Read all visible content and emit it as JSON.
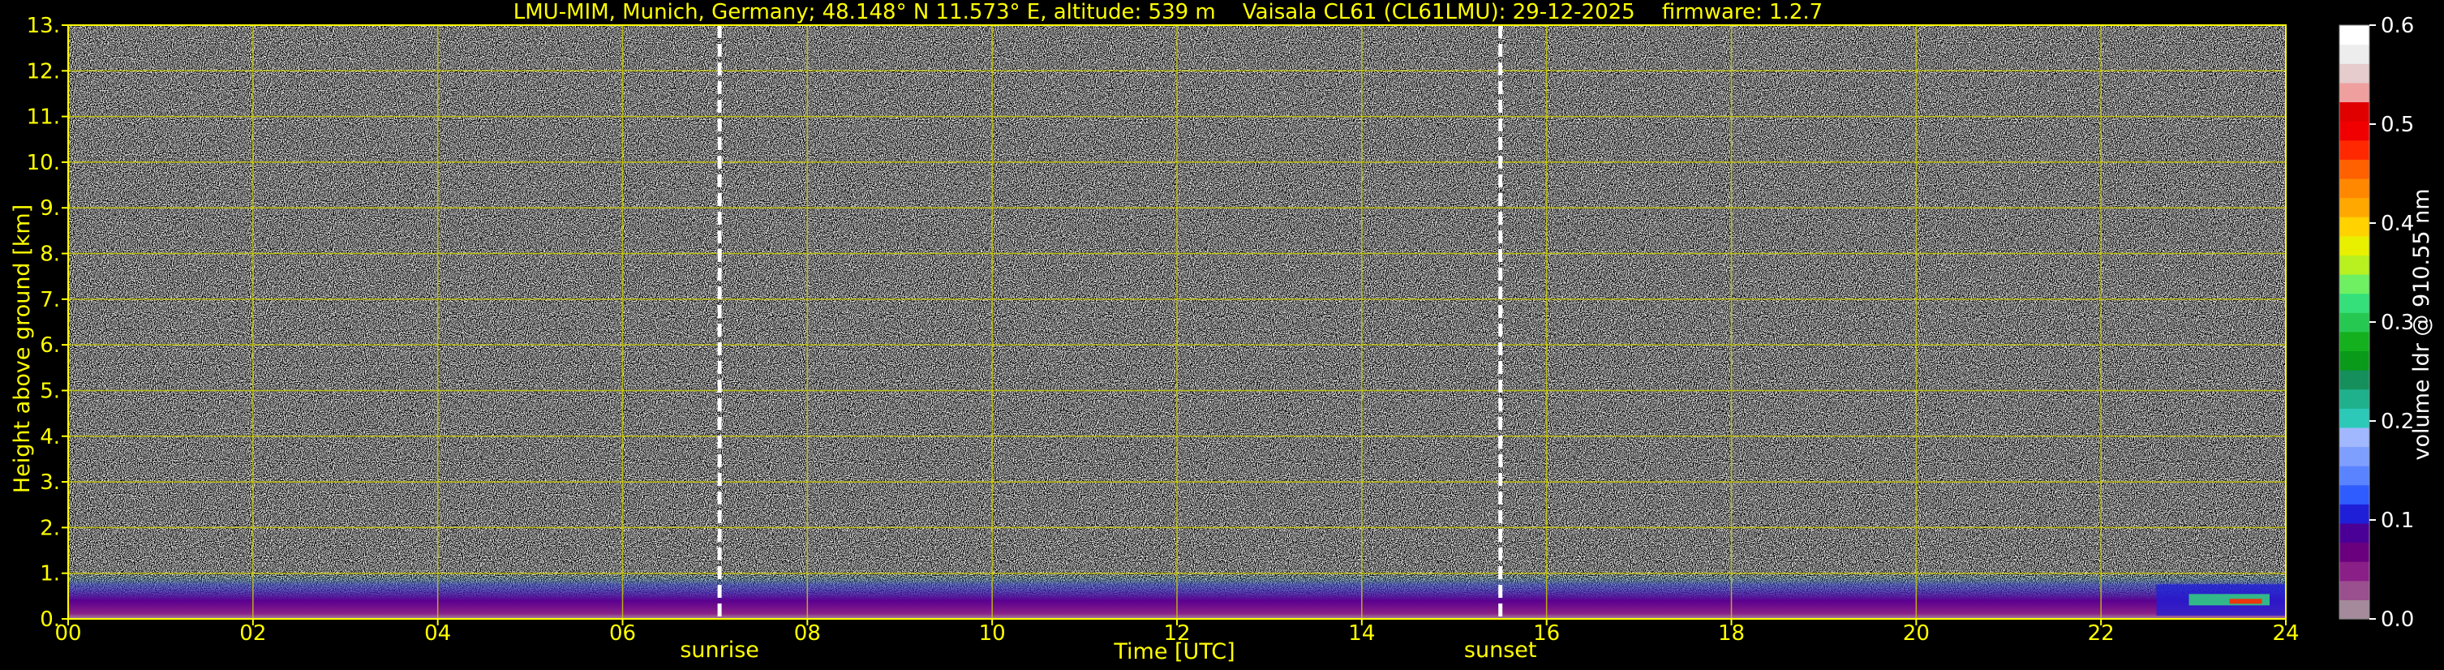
{
  "title": {
    "station": "LMU-MIM, Munich, Germany; 48.148° N 11.573° E, altitude: 539 m",
    "instrument": "Vaisala CL61 (CL61LMU): 29-12-2025",
    "firmware": "firmware: 1.2.7"
  },
  "chart_data": {
    "type": "heatmap",
    "title": "LMU-MIM, Munich, Germany; 48.148° N 11.573° E, altitude: 539 m    Vaisala CL61 (CL61LMU): 29-12-2025    firmware: 1.2.7",
    "xlabel": "Time [UTC]",
    "ylabel": "Height above ground [km]",
    "xlim": [
      0,
      24
    ],
    "ylim": [
      0,
      13
    ],
    "x_ticks": [
      "00",
      "02",
      "04",
      "06",
      "08",
      "10",
      "12",
      "14",
      "16",
      "18",
      "20",
      "22",
      "24"
    ],
    "y_ticks": [
      "0.",
      "1.",
      "2.",
      "3.",
      "4.",
      "5.",
      "6.",
      "7.",
      "8.",
      "9.",
      "10.",
      "11.",
      "12.",
      "13."
    ],
    "grid": true,
    "annotations": [
      {
        "label": "sunrise",
        "x": 7.05
      },
      {
        "label": "sunset",
        "x": 15.5
      }
    ],
    "colorbar": {
      "label": "volume ldr @ 910.55 nm",
      "range": [
        0.0,
        0.6
      ],
      "ticks": [
        "0.0",
        "0.1",
        "0.2",
        "0.3",
        "0.4",
        "0.5",
        "0.6"
      ],
      "colors": [
        "#a48a9a",
        "#9a4f8e",
        "#8a1f88",
        "#6a007e",
        "#4a0096",
        "#1f1fd8",
        "#2f5cff",
        "#5a84ff",
        "#7f9fff",
        "#a1b8ff",
        "#2cc9b9",
        "#1fb08c",
        "#158f5c",
        "#0a9a1a",
        "#14b01e",
        "#27c852",
        "#35e07a",
        "#6ff062",
        "#b9f020",
        "#e8f000",
        "#ffd200",
        "#ffa800",
        "#ff8800",
        "#ff6000",
        "#ff2800",
        "#f00000",
        "#e00000",
        "#f09f9f",
        "#e6cccc",
        "#ededed",
        "#ffffff"
      ]
    },
    "description_values": {
      "noise_above_km": 1.0,
      "ldr_near_ground": 0.05,
      "high_ldr_patch_hours": [
        22.6,
        24
      ],
      "high_ldr_patch_km": [
        0.0,
        0.9
      ]
    }
  },
  "colors": {
    "axis": "#ffff00",
    "grid": "#c8c800",
    "background": "#000000",
    "marker": "#ffffff"
  }
}
